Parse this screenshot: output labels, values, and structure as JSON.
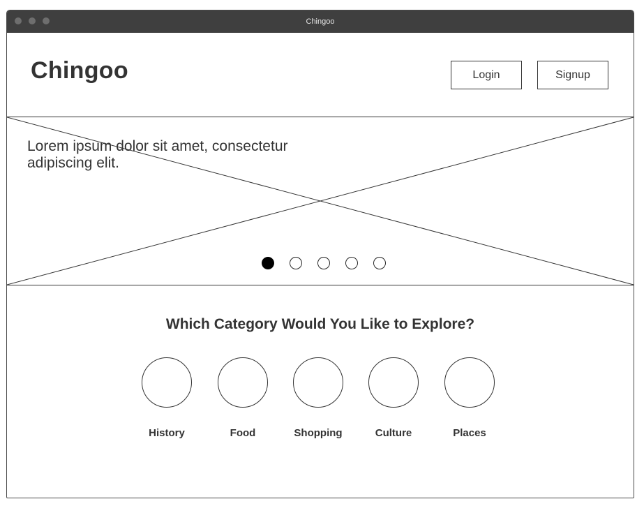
{
  "window": {
    "title": "Chingoo"
  },
  "header": {
    "brand": "Chingoo",
    "login_label": "Login",
    "signup_label": "Signup"
  },
  "hero": {
    "text": "Lorem ipsum dolor sit amet, consectetur adipiscing elit.",
    "image_placeholder": "image-placeholder-icon",
    "slide_count": 5,
    "active_slide": 1
  },
  "explore": {
    "title": "Which Category Would You Like to Explore?",
    "categories": [
      {
        "label": "History"
      },
      {
        "label": "Food"
      },
      {
        "label": "Shopping"
      },
      {
        "label": "Culture"
      },
      {
        "label": "Places"
      }
    ]
  },
  "colors": {
    "titlebar": "#3f3f3f",
    "stroke": "#333333",
    "active_dot": "#000000"
  }
}
